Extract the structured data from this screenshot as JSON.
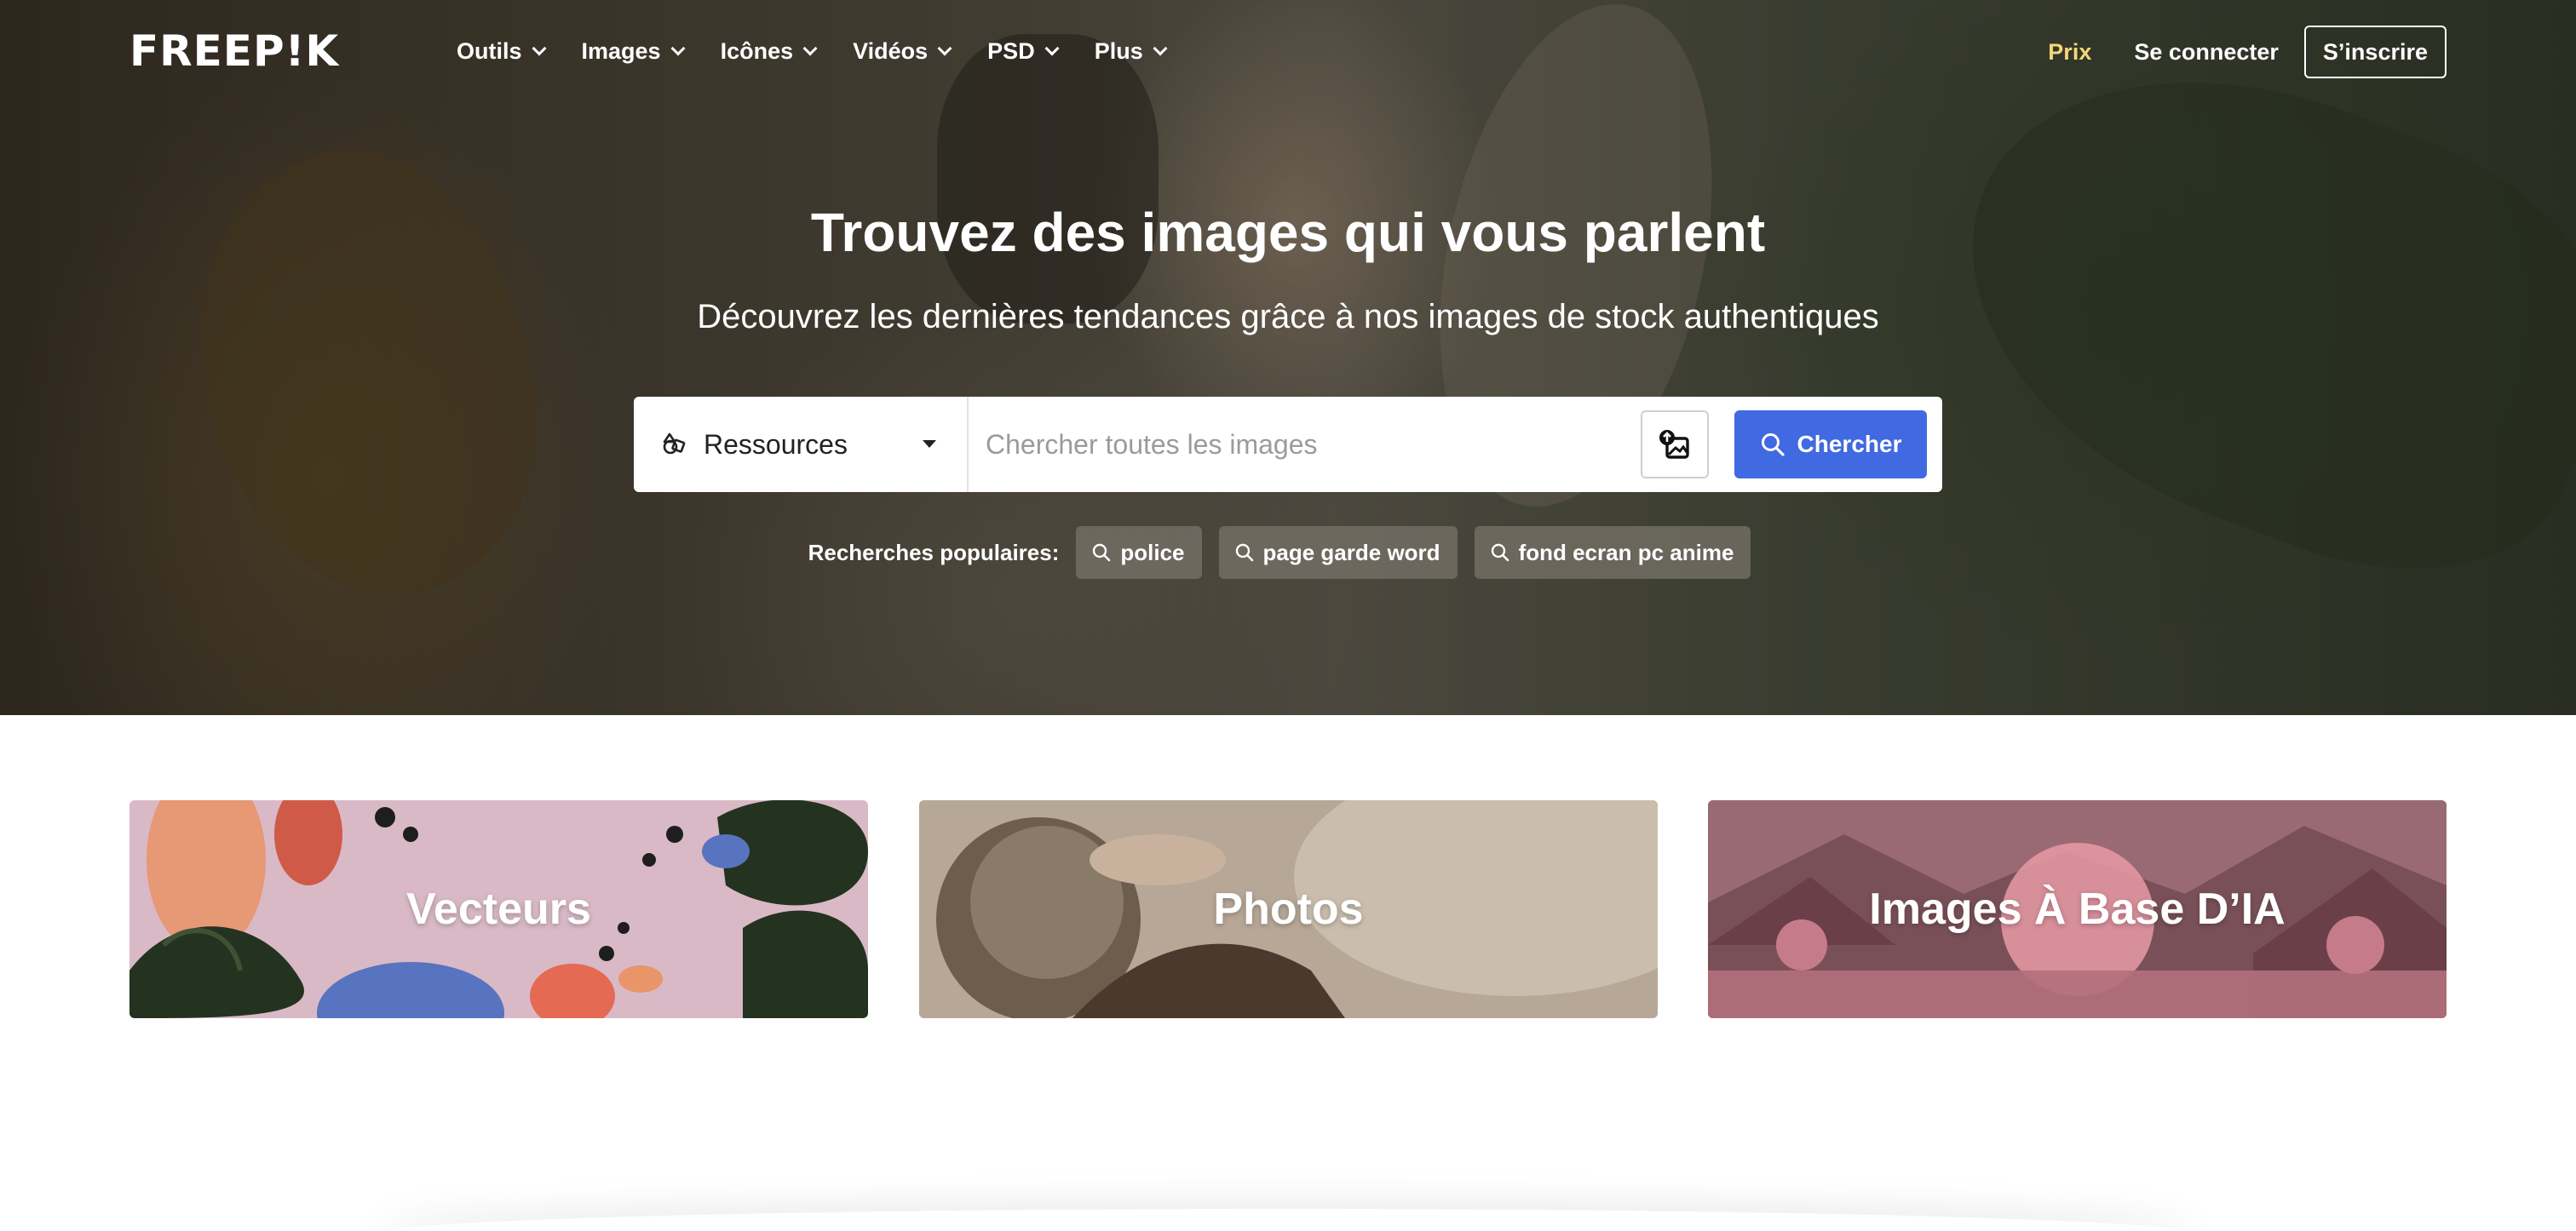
{
  "brand": {
    "logo_text": "FREEP!K"
  },
  "nav": {
    "items": [
      {
        "label": "Outils"
      },
      {
        "label": "Images"
      },
      {
        "label": "Icônes"
      },
      {
        "label": "Vidéos"
      },
      {
        "label": "PSD"
      },
      {
        "label": "Plus"
      }
    ],
    "pricing_label": "Prix",
    "login_label": "Se connecter",
    "signup_label": "S’inscrire"
  },
  "hero": {
    "title": "Trouvez des images qui vous parlent",
    "subtitle": "Découvrez les dernières tendances grâce à nos images de stock authentiques"
  },
  "search": {
    "resource_selected": "Ressources",
    "placeholder": "Chercher toutes les images",
    "value": "",
    "button_label": "Chercher"
  },
  "popular": {
    "label": "Recherches populaires:",
    "tags": [
      "police",
      "page garde word",
      "fond ecran pc anime"
    ]
  },
  "categories": [
    {
      "label": "Vecteurs"
    },
    {
      "label": "Photos"
    },
    {
      "label": "Images À Base D’IA"
    }
  ],
  "colors": {
    "accent_blue": "#4169e1",
    "pricing_yellow": "#f5d77a"
  },
  "icons": {
    "search": "search-icon",
    "image_search": "image-search-icon",
    "resources": "resources-icon",
    "chevron": "chevron-down-icon"
  }
}
